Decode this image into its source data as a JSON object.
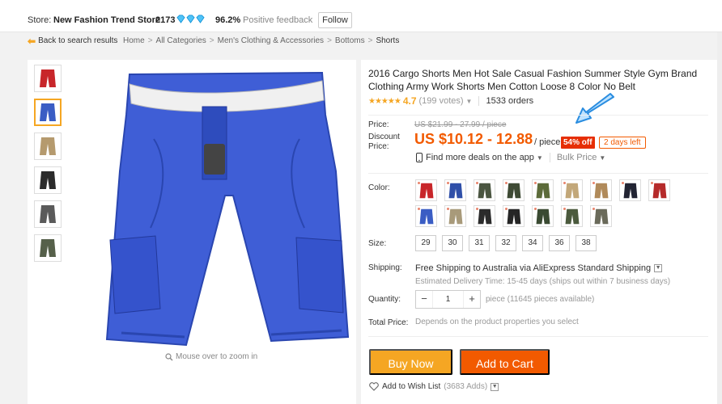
{
  "topbar": {
    "store_label": "Store:",
    "store_name": "New Fashion Trend Store",
    "store_score": "2173",
    "diamond_icon": "diamond-icon",
    "feedback_pct": "96.2%",
    "feedback_label": "Positive feedback",
    "follow_label": "Follow"
  },
  "navbar": {
    "back_label": "Back to search results",
    "breadcrumbs": [
      "Home",
      "All Categories",
      "Men's Clothing & Accessories",
      "Bottoms",
      "Shorts"
    ]
  },
  "gallery": {
    "zoom_hint": "Mouse over to zoom in",
    "thumb_colors": [
      "#c8262a",
      "#3a5dc4",
      "#b59a6e",
      "#2b2b2b",
      "#5a5a5a",
      "#56604a"
    ],
    "selected_index": 1
  },
  "product": {
    "title": "2016 Cargo Shorts Men Hot Sale Casual Fashion Summer Style Gym Brand Clothing Army Work Shorts Men Cotton Loose 8 Color No Belt",
    "stars": "★★★★★",
    "rating": "4.7",
    "votes": "(199 votes)",
    "orders": "1533 orders"
  },
  "pricing": {
    "price_label": "Price:",
    "original_price": "US $21.99 - 27.99 / piece",
    "discount_label_line1": "Discount",
    "discount_label_line2": "Price:",
    "discount_price": "US $10.12 - 12.88",
    "per_piece": "/ piece",
    "off_badge": "54% off",
    "days_left": "2 days left",
    "app_deals": "Find more deals on the app",
    "bulk_price": "Bulk Price"
  },
  "options": {
    "color_label": "Color:",
    "colors": [
      "#c8262a",
      "#2f4fa8",
      "#4a5540",
      "#3e4a34",
      "#5c6b3a",
      "#c2a779",
      "#b08a5a",
      "#222433",
      "#b52a2a",
      "#3a5dc4",
      "#a89a7a",
      "#2b2b2b",
      "#262626",
      "#3a4a32",
      "#4b5a3d",
      "#6a6a5a"
    ],
    "size_label": "Size:",
    "sizes": [
      "29",
      "30",
      "31",
      "32",
      "34",
      "36",
      "38"
    ]
  },
  "shipping": {
    "label": "Shipping:",
    "method": "Free Shipping to Australia via AliExpress Standard Shipping",
    "delivery": "Estimated Delivery Time: 15-45 days (ships out within 7 business days)"
  },
  "quantity": {
    "label": "Quantity:",
    "minus": "−",
    "value": "1",
    "plus": "+",
    "note": "piece (11645 pieces available)"
  },
  "total": {
    "label": "Total Price:",
    "value": "Depends on the product properties you select"
  },
  "actions": {
    "buy_now": "Buy Now",
    "add_to_cart": "Add to Cart",
    "wish_label": "Add to Wish List",
    "wish_count": "(3683 Adds)"
  }
}
